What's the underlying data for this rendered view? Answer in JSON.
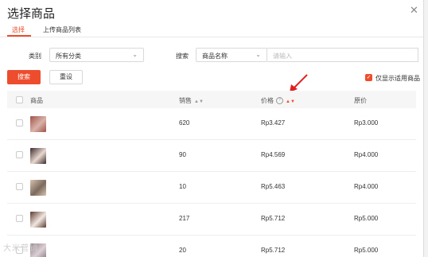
{
  "dialog": {
    "title": "选择商品"
  },
  "tabs": [
    {
      "label": "选择"
    },
    {
      "label": "上传商品列表"
    }
  ],
  "filters": {
    "category_label": "类别",
    "category_value": "所有分类",
    "search_label": "搜索",
    "search_field_value": "商品名称",
    "search_placeholder": "请输入"
  },
  "buttons": {
    "search": "搜索",
    "reset": "重设"
  },
  "only_applicable": {
    "label": "仅显示适用商品",
    "checked": true
  },
  "table": {
    "headers": {
      "product": "商品",
      "sales": "销售",
      "price": "价格",
      "original_price": "原价"
    },
    "rows": [
      {
        "sales": "620",
        "price": "Rp3.427",
        "original_price": "Rp3.000",
        "thumb_colors": [
          "#a0524b",
          "#d9b3a8"
        ]
      },
      {
        "sales": "90",
        "price": "Rp4.569",
        "original_price": "Rp4.000",
        "thumb_colors": [
          "#3b2a2a",
          "#e8d8d0"
        ]
      },
      {
        "sales": "10",
        "price": "Rp5.463",
        "original_price": "Rp4.000",
        "thumb_colors": [
          "#d7c2ad",
          "#7b6a5d"
        ]
      },
      {
        "sales": "217",
        "price": "Rp5.712",
        "original_price": "Rp5.000",
        "thumb_colors": [
          "#5e3b2e",
          "#f1e7e2"
        ]
      },
      {
        "sales": "20",
        "price": "Rp5.712",
        "original_price": "Rp5.000",
        "thumb_colors": [
          "#8a7a80",
          "#dcd0d6"
        ]
      }
    ]
  },
  "watermark": "大米营销",
  "colors": {
    "accent": "#ee4d2d"
  }
}
